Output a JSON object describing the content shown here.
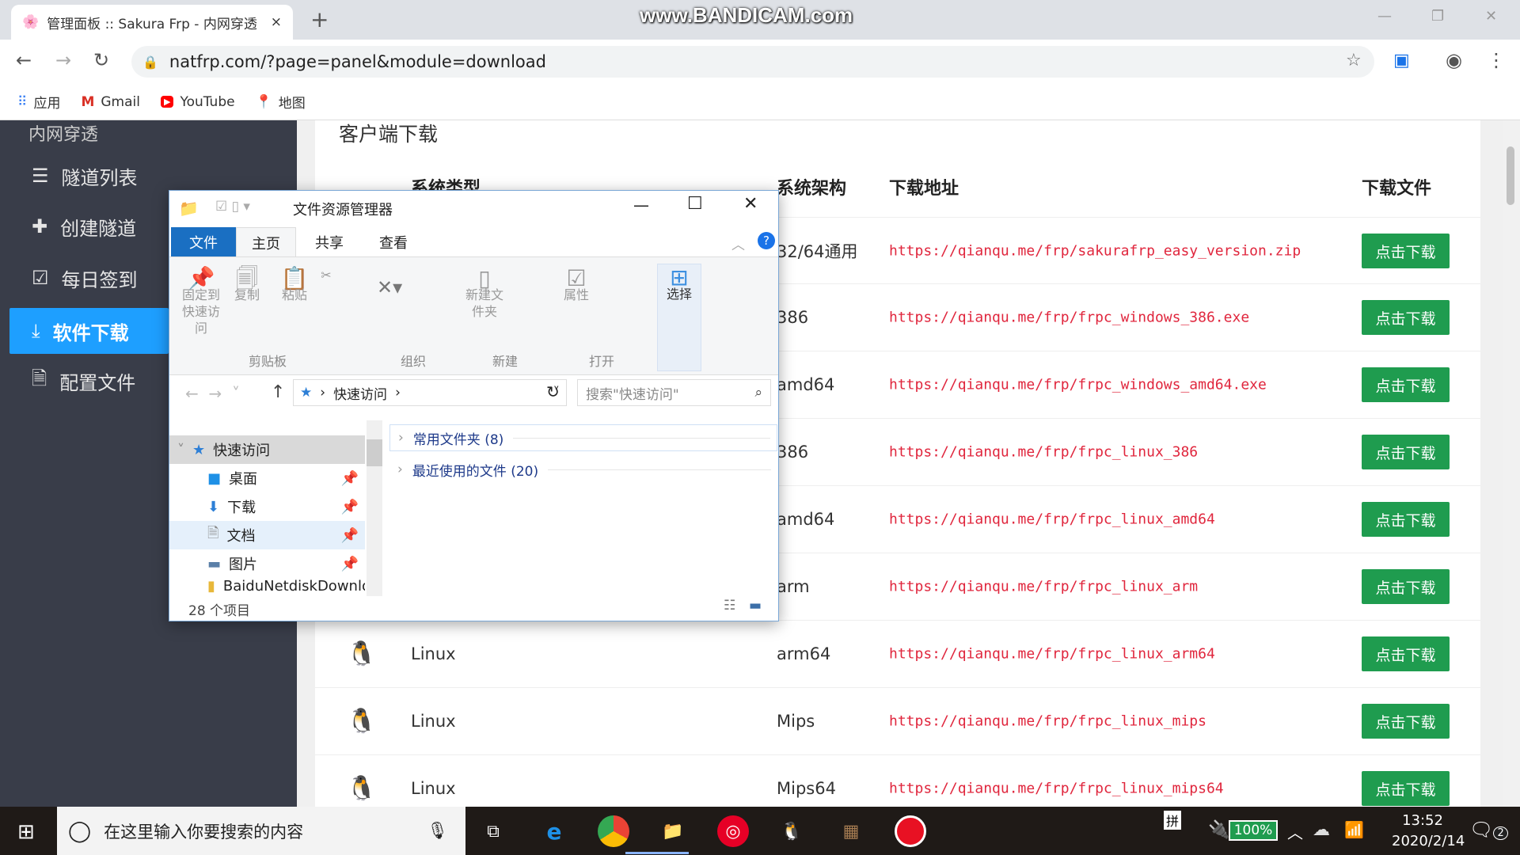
{
  "browser": {
    "tab_title": "管理面板 :: Sakura Frp - 内网穿透",
    "new_tab": "+",
    "tab_close": "×",
    "url": "natfrp.com/?page=panel&module=download",
    "watermark": "www.BANDICAM.com",
    "bookmarks": [
      {
        "label": "应用",
        "icon": "apps-grid-icon"
      },
      {
        "label": "Gmail",
        "icon": "gmail-icon"
      },
      {
        "label": "YouTube",
        "icon": "youtube-icon"
      },
      {
        "label": "地图",
        "icon": "maps-icon"
      }
    ]
  },
  "sidebar": {
    "section": "内网穿透",
    "items": [
      {
        "label": "隧道列表",
        "icon": "list-icon"
      },
      {
        "label": "创建隧道",
        "icon": "plus-icon"
      },
      {
        "label": "每日签到",
        "icon": "checkbox-icon"
      },
      {
        "label": "软件下载",
        "icon": "download-icon",
        "active": true
      },
      {
        "label": "配置文件",
        "icon": "file-icon"
      }
    ]
  },
  "main": {
    "title": "客户端下载",
    "headers": {
      "type": "系统类型",
      "arch": "系统架构",
      "url": "下载地址",
      "file": "下载文件"
    },
    "button_label": "点击下载",
    "button_color": "#1f9c4f",
    "rows": [
      {
        "type": "",
        "arch": "32/64通用",
        "url": "https://qianqu.me/frp/sakurafrp_easy_version.zip"
      },
      {
        "type": "",
        "arch": "386",
        "url": "https://qianqu.me/frp/frpc_windows_386.exe"
      },
      {
        "type": "",
        "arch": "amd64",
        "url": "https://qianqu.me/frp/frpc_windows_amd64.exe"
      },
      {
        "type": "",
        "arch": "386",
        "url": "https://qianqu.me/frp/frpc_linux_386"
      },
      {
        "type": "",
        "arch": "amd64",
        "url": "https://qianqu.me/frp/frpc_linux_amd64"
      },
      {
        "type": "",
        "arch": "arm",
        "url": "https://qianqu.me/frp/frpc_linux_arm"
      },
      {
        "type": "Linux",
        "arch": "arm64",
        "url": "https://qianqu.me/frp/frpc_linux_arm64"
      },
      {
        "type": "Linux",
        "arch": "Mips",
        "url": "https://qianqu.me/frp/frpc_linux_mips"
      },
      {
        "type": "Linux",
        "arch": "Mips64",
        "url": "https://qianqu.me/frp/frpc_linux_mips64"
      }
    ]
  },
  "explorer": {
    "title": "文件资源管理器",
    "tabs": [
      "文件",
      "主页",
      "共享",
      "查看"
    ],
    "ribbon": {
      "pin": "固定到快速访问",
      "copy": "复制",
      "paste": "粘贴",
      "new_folder": "新建文件夹",
      "properties": "属性",
      "select": "选择",
      "groups": [
        "剪贴板",
        "组织",
        "新建",
        "打开"
      ]
    },
    "breadcrumb": "快速访问",
    "search_placeholder": "搜索\"快速访问\"",
    "tree": [
      "快速访问",
      "桌面",
      "下载",
      "文档",
      "图片",
      "BaiduNetdiskDownload"
    ],
    "groups": [
      "常用文件夹 (8)",
      "最近使用的文件 (20)"
    ],
    "status": "28 个项目"
  },
  "taskbar": {
    "search_placeholder": "在这里输入你要搜索的内容",
    "ime": "拼",
    "battery": "100%",
    "battery_level": 100,
    "time": "13:52",
    "date": "2020/2/14",
    "notifications": "2"
  }
}
